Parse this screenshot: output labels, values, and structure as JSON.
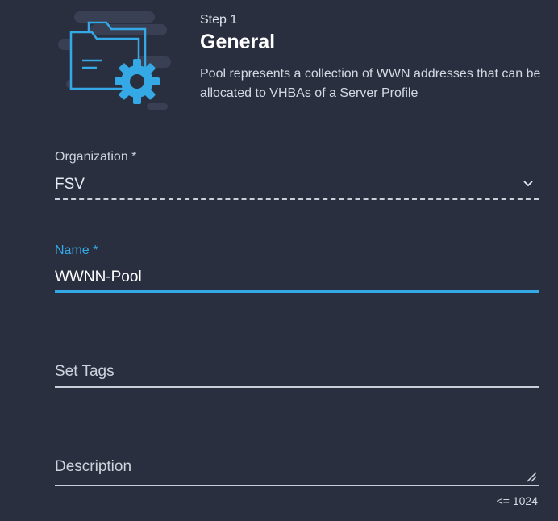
{
  "header": {
    "step": "Step 1",
    "title": "General",
    "description": "Pool represents a collection of WWN addresses that can be allocated to VHBAs of a Server Profile",
    "illustration_icon": "folder-gear-icon"
  },
  "form": {
    "organization": {
      "label": "Organization *",
      "value": "FSV",
      "icon": "chevron-down-icon"
    },
    "name": {
      "label": "Name *",
      "value": "WWNN-Pool"
    },
    "tags": {
      "placeholder": "Set Tags"
    },
    "description": {
      "placeholder": "Description",
      "limit": "<= 1024"
    }
  },
  "colors": {
    "background": "#2a2f40",
    "accent": "#35a9e6",
    "text": "#e8ebf2"
  }
}
